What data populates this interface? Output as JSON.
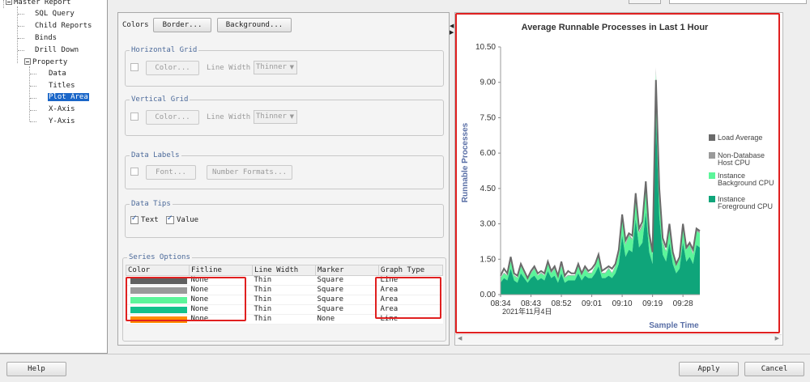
{
  "tree": {
    "items": [
      {
        "label": "Master Report"
      },
      {
        "label": "SQL Query"
      },
      {
        "label": "Child Reports"
      },
      {
        "label": "Binds"
      },
      {
        "label": "Drill Down"
      },
      {
        "label": "Property"
      },
      {
        "label": "Data"
      },
      {
        "label": "Titles"
      },
      {
        "label": "Plot Area"
      },
      {
        "label": "X-Axis"
      },
      {
        "label": "Y-Axis"
      }
    ],
    "selected": "Plot Area"
  },
  "settings": {
    "colors_label": "Colors",
    "border_button": "Border...",
    "background_button": "Background...",
    "horizontal_grid": {
      "title": "Horizontal Grid",
      "color_button": "Color...",
      "line_width_label": "Line Width",
      "line_width_value": "Thinner"
    },
    "vertical_grid": {
      "title": "Vertical Grid",
      "color_button": "Color...",
      "line_width_label": "Line Width",
      "line_width_value": "Thinner"
    },
    "data_labels": {
      "title": "Data Labels",
      "font_button": "Font...",
      "number_formats_button": "Number Formats..."
    },
    "data_tips": {
      "title": "Data Tips",
      "text_label": "Text",
      "value_label": "Value"
    },
    "series_options": {
      "title": "Series Options",
      "columns": [
        "Color",
        "Fitline",
        "Line Width",
        "Marker",
        "Graph Type"
      ],
      "rows": [
        {
          "color": "#606060",
          "fitline": "None",
          "line_width": "Thin",
          "marker": "Square",
          "graph_type": "Line"
        },
        {
          "color": "#9a9a9a",
          "fitline": "None",
          "line_width": "Thin",
          "marker": "Square",
          "graph_type": "Area"
        },
        {
          "color": "#5cf59a",
          "fitline": "None",
          "line_width": "Thin",
          "marker": "Square",
          "graph_type": "Area"
        },
        {
          "color": "#12c18b",
          "fitline": "None",
          "line_width": "Thin",
          "marker": "Square",
          "graph_type": "Area"
        },
        {
          "color": "#ff8c00",
          "fitline": "None",
          "line_width": "Thin",
          "marker": "None",
          "graph_type": "Line"
        }
      ]
    }
  },
  "buttons": {
    "help": "Help",
    "apply": "Apply",
    "cancel": "Cancel"
  },
  "chart_data": {
    "type": "area",
    "title": "Average Runnable Processes in Last 1 Hour",
    "xlabel": "Sample Time",
    "ylabel": "Runnable Processes",
    "x_tick_labels": [
      "08:34",
      "08:43",
      "08:52",
      "09:01",
      "09:10",
      "09:19",
      "09:28"
    ],
    "x_date_label": "2021年11月4日",
    "y_ticks": [
      "0.00",
      "1.50",
      "3.00",
      "4.50",
      "6.00",
      "7.50",
      "9.00",
      "10.50"
    ],
    "ylim": [
      0,
      10.5
    ],
    "xlim": [
      0,
      59
    ],
    "legend_position": "right",
    "colors": {
      "load_average": "#6a6a6a",
      "non_db_cpu": "#9a9a9a",
      "bg_cpu": "#5cf59a",
      "fg_cpu": "#0fa57a"
    },
    "series": [
      {
        "name": "Load Average",
        "type": "line",
        "values": [
          0.8,
          1.1,
          0.9,
          1.6,
          0.9,
          0.8,
          1.3,
          1.0,
          0.7,
          1.0,
          1.2,
          0.9,
          1.0,
          0.9,
          1.4,
          1.0,
          1.2,
          0.8,
          1.4,
          0.8,
          1.0,
          0.9,
          0.9,
          1.3,
          0.9,
          1.2,
          1.0,
          1.1,
          1.3,
          1.7,
          1.0,
          1.1,
          1.2,
          1.1,
          1.3,
          1.9,
          3.4,
          2.3,
          2.6,
          2.5,
          4.3,
          2.8,
          3.1,
          4.8,
          2.6,
          1.8,
          9.1,
          4.5,
          2.4,
          2.0,
          3.0,
          1.8,
          1.3,
          1.6,
          3.0,
          2.0,
          2.2,
          1.9,
          2.8,
          2.7
        ]
      },
      {
        "name": "Non-Database Host CPU",
        "type": "area",
        "values": [
          0.5,
          0.6,
          0.5,
          0.8,
          0.5,
          0.5,
          0.7,
          0.6,
          0.4,
          0.6,
          0.7,
          0.5,
          0.6,
          0.5,
          0.8,
          0.6,
          0.7,
          0.5,
          0.8,
          0.5,
          0.6,
          0.5,
          0.5,
          0.7,
          0.5,
          0.7,
          0.6,
          0.6,
          0.7,
          0.9,
          0.6,
          0.6,
          0.7,
          0.6,
          0.7,
          1.0,
          1.8,
          1.2,
          1.4,
          1.3,
          2.2,
          1.5,
          1.6,
          2.5,
          1.4,
          1.0,
          4.6,
          2.3,
          1.3,
          1.1,
          1.6,
          1.0,
          0.7,
          0.9,
          1.6,
          1.1,
          1.2,
          1.0,
          1.5,
          1.4
        ]
      },
      {
        "name": "Instance Background CPU",
        "type": "area",
        "values": [
          0.2,
          0.2,
          0.2,
          0.3,
          0.2,
          0.2,
          0.3,
          0.2,
          0.2,
          0.2,
          0.3,
          0.2,
          0.2,
          0.2,
          0.3,
          0.2,
          0.3,
          0.2,
          0.3,
          0.2,
          0.2,
          0.2,
          0.2,
          0.3,
          0.2,
          0.3,
          0.2,
          0.2,
          0.3,
          0.4,
          0.2,
          0.2,
          0.3,
          0.2,
          0.3,
          0.4,
          0.8,
          0.5,
          0.6,
          0.5,
          0.9,
          0.6,
          0.7,
          1.0,
          0.6,
          0.4,
          1.9,
          1.0,
          0.5,
          0.4,
          0.7,
          0.4,
          0.3,
          0.4,
          0.7,
          0.5,
          0.5,
          0.4,
          0.6,
          0.6
        ]
      },
      {
        "name": "Instance Foreground CPU",
        "type": "area",
        "values": [
          0.5,
          0.7,
          0.6,
          1.1,
          0.6,
          0.5,
          0.9,
          0.7,
          0.5,
          0.7,
          0.8,
          0.6,
          0.7,
          0.6,
          1.0,
          0.7,
          0.8,
          0.5,
          0.9,
          0.5,
          0.6,
          0.6,
          0.6,
          0.9,
          0.6,
          0.8,
          0.7,
          0.7,
          0.9,
          1.2,
          0.7,
          0.7,
          0.8,
          0.7,
          0.9,
          1.3,
          2.5,
          1.6,
          1.9,
          1.8,
          3.2,
          2.0,
          2.2,
          3.5,
          1.8,
          1.3,
          7.5,
          3.3,
          1.7,
          1.4,
          2.2,
          1.3,
          0.9,
          1.1,
          2.2,
          1.4,
          1.6,
          1.3,
          2.1,
          2.0
        ]
      }
    ]
  }
}
